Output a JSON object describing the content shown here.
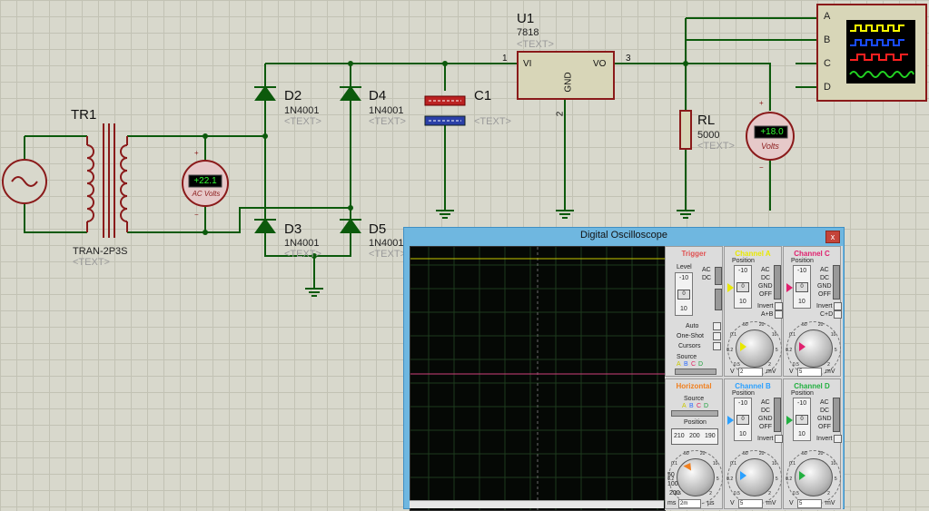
{
  "transformer": {
    "ref": "TR1",
    "model": "TRAN-2P3S",
    "text": "<TEXT>"
  },
  "ac_voltmeter": {
    "reading": "+22.1",
    "unit": "AC Volts",
    "plus": "+",
    "minus": "−"
  },
  "diodes": [
    {
      "ref": "D2",
      "model": "1N4001",
      "text": "<TEXT>"
    },
    {
      "ref": "D4",
      "model": "1N4001",
      "text": "<TEXT>"
    },
    {
      "ref": "D3",
      "model": "1N4001",
      "text": "<TEXT>"
    },
    {
      "ref": "D5",
      "model": "1N4001",
      "text": "<TEXT>"
    }
  ],
  "capacitor": {
    "ref": "C1",
    "text": "<TEXT>"
  },
  "regulator": {
    "ref": "U1",
    "model": "7818",
    "text": "<TEXT>",
    "pin_vi": "VI",
    "pin_vo": "VO",
    "pin_gnd": "GND",
    "pin1": "1",
    "pin2": "2",
    "pin3": "3"
  },
  "load": {
    "ref": "RL",
    "value": "5000",
    "text": "<TEXT>"
  },
  "dc_voltmeter": {
    "reading": "+18.0",
    "unit": "Volts",
    "plus": "+",
    "minus": "−"
  },
  "scope_symbol": {
    "channels": [
      "A",
      "B",
      "C",
      "D"
    ],
    "trace_colors": [
      "#ffff00",
      "#1a4cff",
      "#ff2020",
      "#22d422"
    ]
  },
  "oscilloscope": {
    "title": "Digital Oscilloscope",
    "close": "x",
    "trigger": {
      "title": "Trigger",
      "level": "Level",
      "ticks": [
        "-10",
        "0",
        "10"
      ],
      "ac": "AC",
      "dc": "DC",
      "auto": "Auto",
      "one_shot": "One-Shot",
      "cursors": "Cursors",
      "source": "Source",
      "src_ch": [
        "A",
        "B",
        "C",
        "D"
      ]
    },
    "channel_a": {
      "title": "Channel A",
      "position": "Position",
      "ticks": [
        "-10",
        "0",
        "10"
      ],
      "modes": [
        "AC",
        "DC",
        "GND",
        "OFF"
      ],
      "invert": "Invert",
      "combine": "A+B",
      "value": "2",
      "unit_left": "V",
      "unit_right": "mV",
      "color": "#e8e800"
    },
    "channel_c": {
      "title": "Channel C",
      "position": "Position",
      "ticks": [
        "-10",
        "0",
        "10"
      ],
      "modes": [
        "AC",
        "DC",
        "GND",
        "OFF"
      ],
      "invert": "Invert",
      "combine": "C+D",
      "value": "5",
      "unit_left": "V",
      "unit_right": "mV",
      "color": "#e0206e"
    },
    "horizontal": {
      "title": "Horizontal",
      "source": "Source",
      "src_ch": [
        "A",
        "B",
        "C",
        "D"
      ],
      "position": "Position",
      "pos_ticks": [
        "210",
        "200",
        "190"
      ],
      "value": "2m",
      "unit_left": "ms",
      "unit_right": "µs",
      "scale_ticks": [
        "200",
        "100",
        "50"
      ],
      "color": "#f08020"
    },
    "channel_b": {
      "title": "Channel B",
      "position": "Position",
      "ticks": [
        "-10",
        "0",
        "10"
      ],
      "modes": [
        "AC",
        "DC",
        "GND",
        "OFF"
      ],
      "invert": "Invert",
      "value": "5",
      "unit_left": "V",
      "unit_right": "mV",
      "color": "#2aa0ff"
    },
    "channel_d": {
      "title": "Channel D",
      "position": "Position",
      "ticks": [
        "-10",
        "0",
        "10"
      ],
      "modes": [
        "AC",
        "DC",
        "GND",
        "OFF"
      ],
      "invert": "Invert",
      "value": "5",
      "unit_left": "V",
      "unit_right": "mV",
      "color": "#22b040"
    },
    "knob_scale": [
      "0.5",
      "0.2",
      "0.1",
      "50",
      "20",
      "10",
      "5",
      "2",
      "1",
      "1",
      "2",
      "5",
      "10",
      "20",
      "50",
      "100",
      "200",
      "0.5",
      "1",
      "2",
      "5",
      "10",
      "20"
    ]
  }
}
